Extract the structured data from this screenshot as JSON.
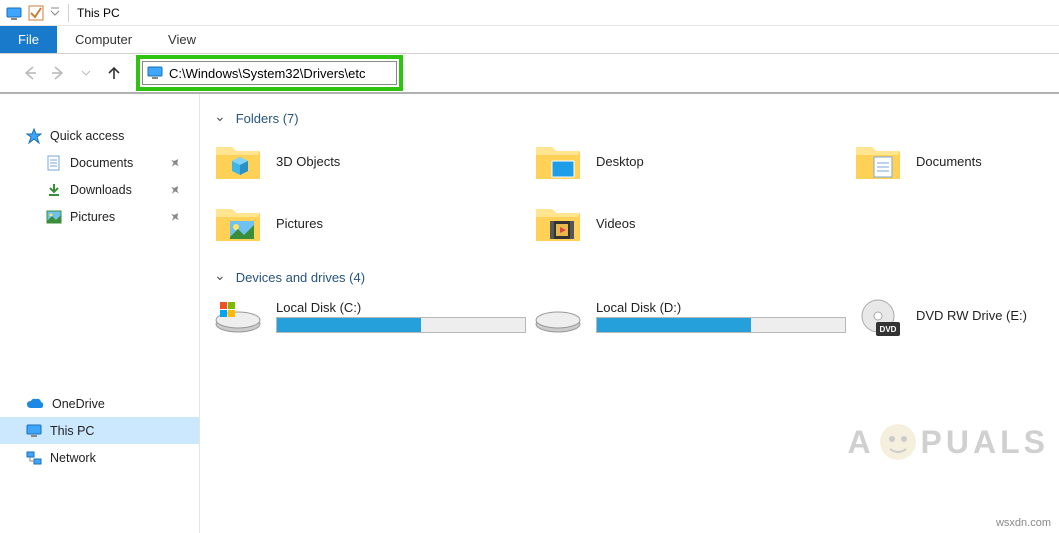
{
  "title": "This PC",
  "ribbon": {
    "file": "File",
    "tabs": [
      "Computer",
      "View"
    ]
  },
  "address": "C:\\Windows\\System32\\Drivers\\etc",
  "sidebar": {
    "quick_access": "Quick access",
    "items": [
      {
        "label": "Documents",
        "pinned": true
      },
      {
        "label": "Downloads",
        "pinned": true
      },
      {
        "label": "Pictures",
        "pinned": true
      }
    ],
    "onedrive": "OneDrive",
    "this_pc": "This PC",
    "network": "Network"
  },
  "groups": {
    "folders": {
      "header": "Folders (7)",
      "items": [
        "3D Objects",
        "Desktop",
        "Documents",
        "Pictures",
        "Videos"
      ]
    },
    "drives": {
      "header": "Devices and drives (4)",
      "items": [
        {
          "name": "Local Disk (C:)",
          "fill": 58,
          "type": "hdd"
        },
        {
          "name": "Local Disk (D:)",
          "fill": 62,
          "type": "hdd"
        },
        {
          "name": "DVD RW Drive (E:)",
          "fill": null,
          "type": "dvd"
        }
      ]
    }
  },
  "watermark": {
    "text_a": "A",
    "text_b": "PUALS"
  },
  "credit": "wsxdn.com"
}
